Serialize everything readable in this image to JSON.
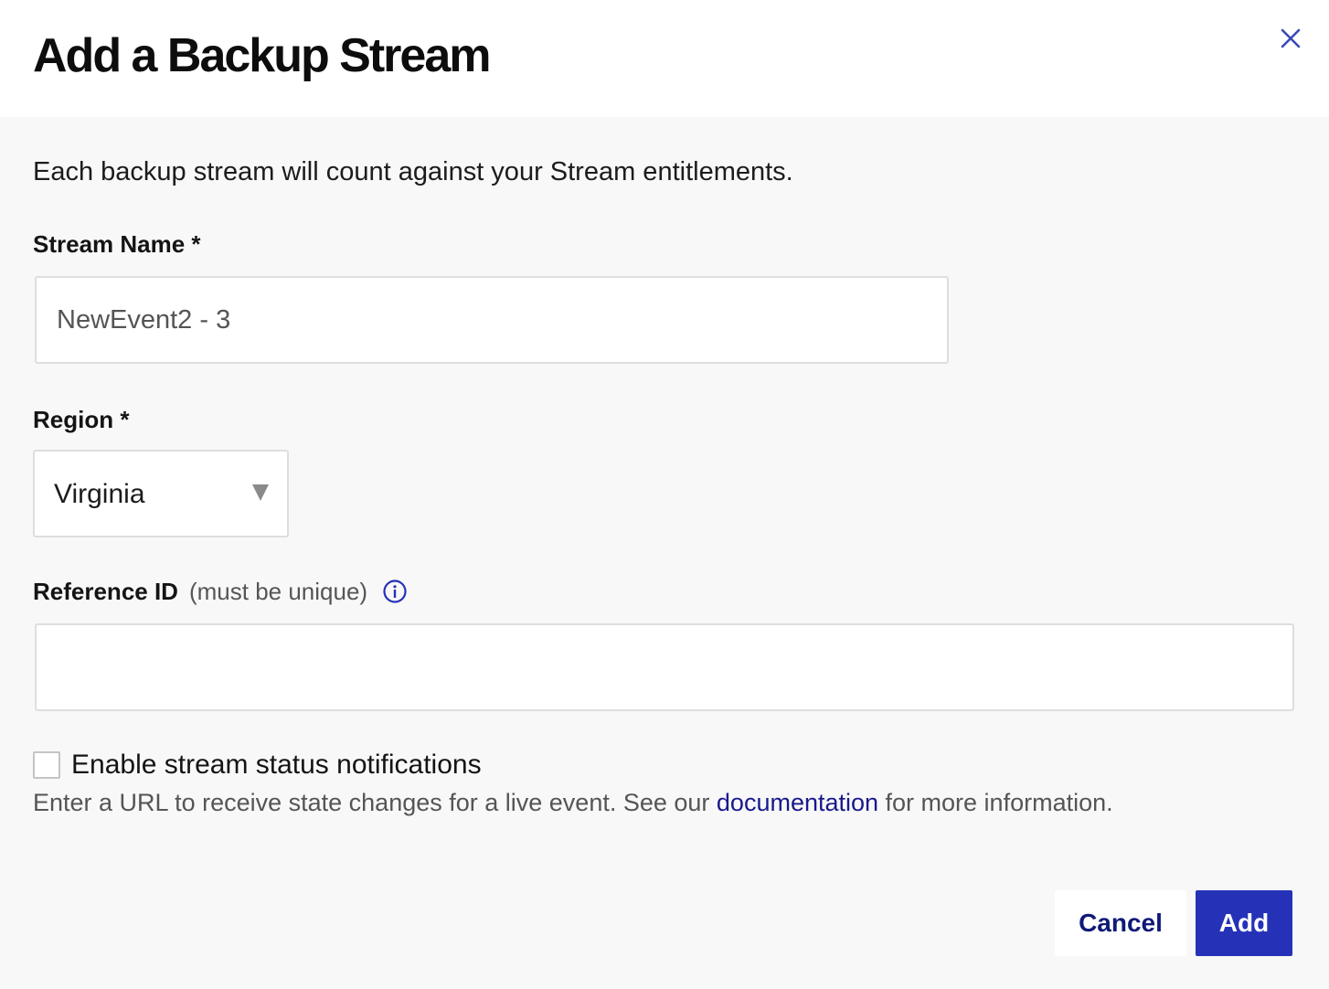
{
  "dialog": {
    "title": "Add a Backup Stream",
    "close_icon": "close-icon",
    "subtitle": "Each backup stream will count against your Stream entitlements."
  },
  "form": {
    "stream_name": {
      "label": "Stream Name *",
      "value": "NewEvent2 - 3"
    },
    "region": {
      "label": "Region *",
      "selected": "Virginia"
    },
    "reference_id": {
      "label": "Reference ID",
      "hint": "(must be unique)",
      "value": "",
      "info_icon": "info-icon"
    },
    "notifications": {
      "checkbox_label": "Enable stream status notifications",
      "checked": false,
      "help_prefix": "Enter a URL to receive state changes for a live event. See our ",
      "help_link": "documentation",
      "help_suffix": " for more information."
    }
  },
  "actions": {
    "cancel_label": "Cancel",
    "add_label": "Add"
  },
  "colors": {
    "accent": "#2532b8",
    "link": "#19198c",
    "close_icon": "#3a48b8",
    "background": "#f8f8f8"
  }
}
